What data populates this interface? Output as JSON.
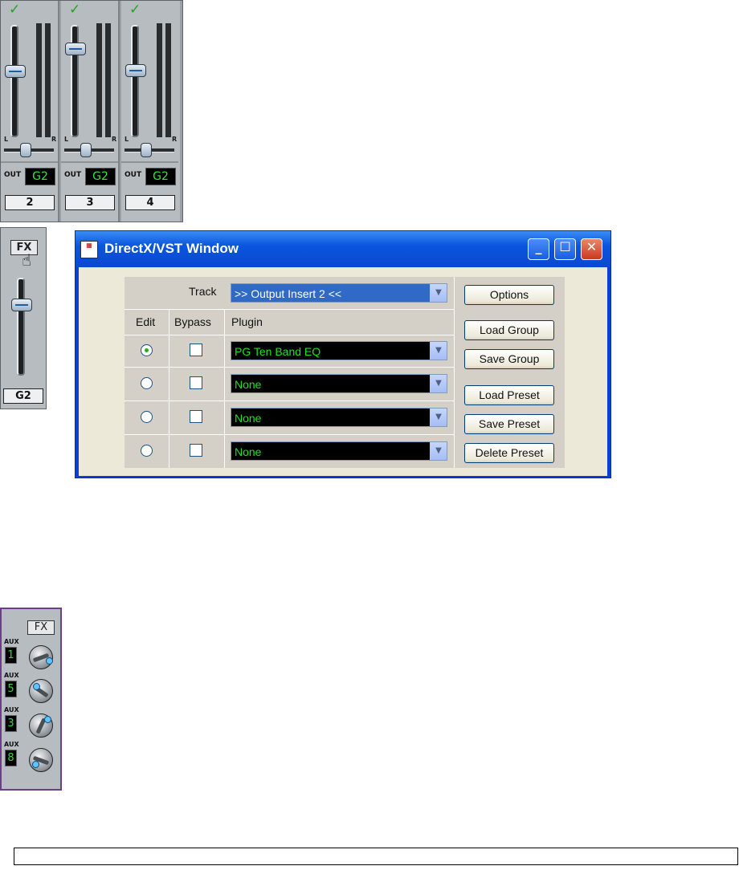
{
  "mixer": {
    "strips": [
      {
        "number": "2",
        "out_label": "OUT",
        "out_value": "G2",
        "pan_left": "L",
        "pan_right": "R"
      },
      {
        "number": "3",
        "out_label": "OUT",
        "out_value": "G2",
        "pan_left": "L",
        "pan_right": "R"
      },
      {
        "number": "4",
        "out_label": "OUT",
        "out_value": "G2",
        "pan_left": "L",
        "pan_right": "R"
      }
    ],
    "check_icon": "checkmark-icon"
  },
  "fx_strip": {
    "fx_label": "FX",
    "group_label": "G2"
  },
  "window": {
    "title": "DirectX/VST Window",
    "track_label": "Track",
    "track_value": ">> Output Insert 2 <<",
    "col_edit": "Edit",
    "col_bypass": "Bypass",
    "col_plugin": "Plugin",
    "rows": [
      {
        "edit_selected": true,
        "bypass": false,
        "plugin": "PG Ten Band EQ"
      },
      {
        "edit_selected": false,
        "bypass": false,
        "plugin": "None"
      },
      {
        "edit_selected": false,
        "bypass": false,
        "plugin": "None"
      },
      {
        "edit_selected": false,
        "bypass": false,
        "plugin": "None"
      }
    ],
    "buttons": {
      "options": "Options",
      "load_group": "Load Group",
      "save_group": "Save Group",
      "load_preset": "Load Preset",
      "save_preset": "Save Preset",
      "delete_preset": "Delete Preset"
    }
  },
  "aux_strip": {
    "fx_label": "FX",
    "sends": [
      {
        "label": "AUX",
        "number": "1"
      },
      {
        "label": "AUX",
        "number": "5"
      },
      {
        "label": "AUX",
        "number": "3"
      },
      {
        "label": "AUX",
        "number": "8"
      }
    ]
  },
  "colors": {
    "title_bar": "#0a55df",
    "lcd_green": "#34e534",
    "panel": "#d4d0c8"
  }
}
